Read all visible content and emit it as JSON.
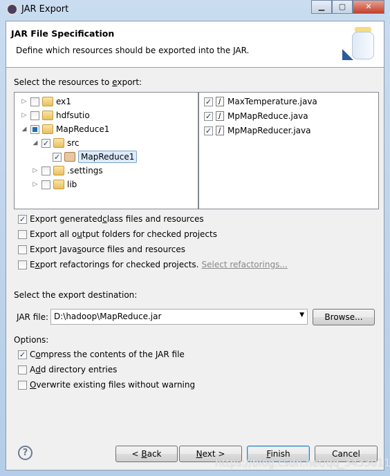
{
  "window": {
    "title": "JAR Export",
    "controls": [
      "minimize",
      "maximize",
      "close"
    ]
  },
  "header": {
    "title": "JAR File Specification",
    "description": "Define which resources should be exported into the JAR."
  },
  "resources": {
    "label": "Select the resources to export:",
    "tree": [
      {
        "label": "ex1",
        "checked": "unchecked",
        "expanded": false,
        "icon": "project-folder-icon"
      },
      {
        "label": "hdfsutio",
        "checked": "unchecked",
        "expanded": false,
        "icon": "project-folder-warning-icon"
      },
      {
        "label": "MapReduce1",
        "checked": "partial",
        "expanded": true,
        "icon": "project-folder-icon"
      },
      {
        "label": "src",
        "checked": "checked",
        "expanded": true,
        "icon": "source-folder-icon"
      },
      {
        "label": "MapReduce1",
        "checked": "checked",
        "selected": true,
        "icon": "package-icon"
      },
      {
        "label": ".settings",
        "checked": "unchecked",
        "expanded": false,
        "icon": "folder-icon"
      },
      {
        "label": "lib",
        "checked": "unchecked",
        "expanded": false,
        "icon": "folder-icon"
      }
    ],
    "files": [
      {
        "label": "MaxTemperature.java",
        "checked": true
      },
      {
        "label": "MpMapReduce.java",
        "checked": true
      },
      {
        "label": "MpMapReducer.java",
        "checked": true
      }
    ]
  },
  "export_options": [
    {
      "pre": "Export generated ",
      "u": "c",
      "post": "lass files and resources",
      "checked": true
    },
    {
      "pre": "Export all o",
      "u": "u",
      "post": "tput folders for checked projects",
      "checked": false
    },
    {
      "pre": "Export Java ",
      "u": "s",
      "post": "ource files and resources",
      "checked": false
    },
    {
      "pre": "E",
      "u": "x",
      "post": "port refactorings for checked projects.",
      "checked": false
    }
  ],
  "select_refactorings": "Select refactorings...",
  "destination": {
    "label": "Select the export destination:",
    "jar_label_u": "J",
    "jar_label_rest": "AR file:",
    "jar_value": "D:\\hadoop\\MapReduce.jar",
    "browse": "Browse..."
  },
  "options": {
    "label": "Options:",
    "items": [
      {
        "pre": "C",
        "u": "o",
        "post": "mpress the contents of the JAR file",
        "checked": true
      },
      {
        "pre": "A",
        "u": "d",
        "post": "d directory entries",
        "checked": false
      },
      {
        "pre": "",
        "u": "O",
        "post": "verwrite existing files without warning",
        "checked": false
      }
    ]
  },
  "buttons": {
    "back_pre": "< ",
    "back_u": "B",
    "back_post": "ack",
    "next_u": "N",
    "next_post": "ext >",
    "finish_u": "F",
    "finish_post": "inish",
    "cancel": "Cancel"
  },
  "watermark": "https://blog.csdn.net/qq_34330118"
}
